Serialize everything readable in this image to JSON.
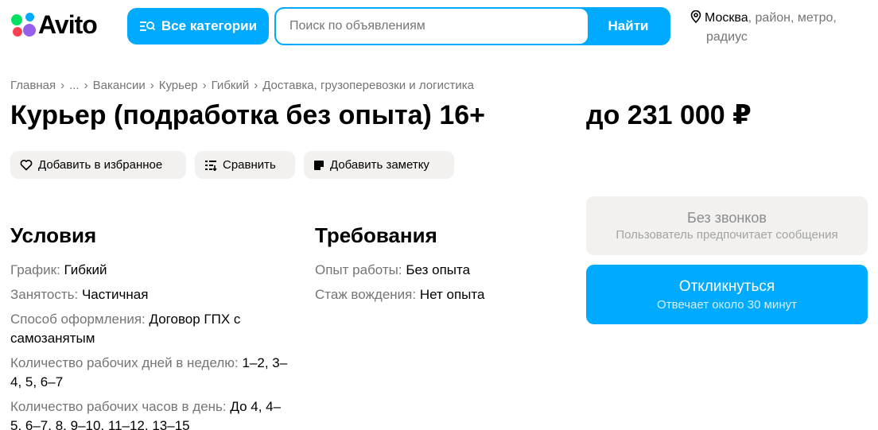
{
  "header": {
    "logo_text": "Avito",
    "categories_label": "Все категории",
    "search_placeholder": "Поиск по объявлениям",
    "search_value": "",
    "search_button": "Найти",
    "location": {
      "city": "Москва",
      "filters_line1": ", район, метро,",
      "filters_line2": "радиус"
    }
  },
  "breadcrumb": [
    "Главная",
    "...",
    "Вакансии",
    "Курьер",
    "Гибкий",
    "Доставка, грузоперевозки и логистика"
  ],
  "breadcrumb_separator": "›",
  "title": "Курьер (подработка без опыта) 16+",
  "price": "до 231 000 ₽",
  "actions": {
    "favorite": "Добавить в избранное",
    "compare": "Сравнить",
    "note": "Добавить заметку"
  },
  "conditions": {
    "title": "Условия",
    "items": [
      {
        "key": "График:",
        "value": "Гибкий"
      },
      {
        "key": "Занятость:",
        "value": "Частичная"
      },
      {
        "key": "Способ оформления:",
        "value": "Договор ГПХ с самозанятым"
      },
      {
        "key": "Количество рабочих дней в неделю:",
        "value": "1–2, 3–4, 5, 6–7"
      },
      {
        "key": "Количество рабочих часов в день:",
        "value": "До 4, 4–5, 6–7, 8, 9–10, 11–12, 13–15"
      }
    ]
  },
  "requirements": {
    "title": "Требования",
    "items": [
      {
        "key": "Опыт работы:",
        "value": "Без опыта"
      },
      {
        "key": "Стаж вождения:",
        "value": "Нет опыта"
      }
    ]
  },
  "contact": {
    "no_calls_title": "Без звонков",
    "no_calls_subtitle": "Пользователь предпочитает сообщения",
    "respond_title": "Откликнуться",
    "respond_subtitle": "Отвечает около 30 минут"
  },
  "colors": {
    "accent": "#00aaff",
    "muted_text": "#757575",
    "pill_bg": "#f2f1f0"
  },
  "icons": [
    "categories-icon",
    "location-pin-icon",
    "heart-icon",
    "compare-icon",
    "note-icon"
  ]
}
